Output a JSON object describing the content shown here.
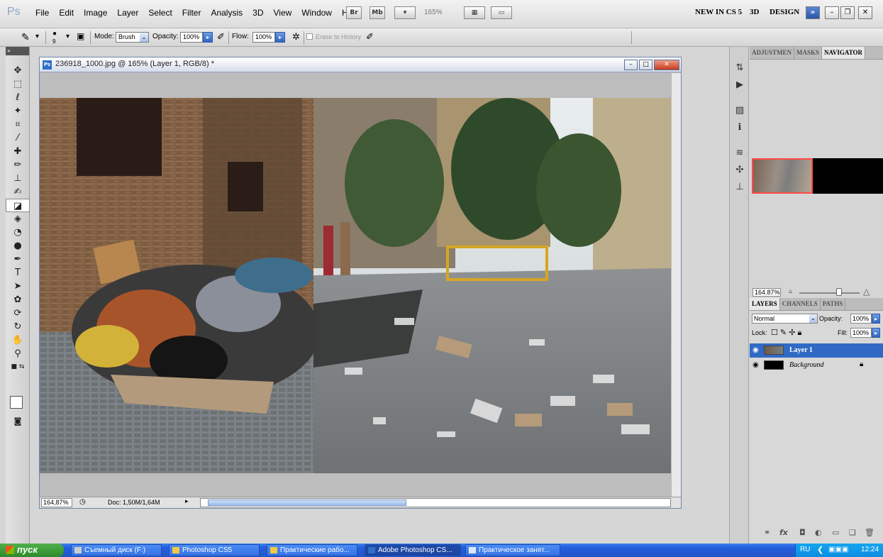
{
  "app": {
    "logo": "Ps",
    "menu": [
      "File",
      "Edit",
      "Image",
      "Layer",
      "Select",
      "Filter",
      "Analysis",
      "3D",
      "View",
      "Window",
      "Help"
    ],
    "bridge": "Br",
    "minibridge": "Mb",
    "zoom_level": "165%",
    "workspaces": [
      "NEW IN CS 5",
      "3D",
      "DESIGN"
    ],
    "more": "»"
  },
  "options": {
    "brush_size": "9",
    "mode_label": "Mode:",
    "mode_value": "Brush",
    "opacity_label": "Opacity:",
    "opacity_value": "100%",
    "flow_label": "Flow:",
    "flow_value": "100%",
    "erase_history": "Erase to History"
  },
  "document": {
    "title": "236918_1000.jpg @ 165% (Layer 1, RGB/8) *",
    "zoom": "164,87%",
    "doc_info": "Doc: 1,50M/1,64M"
  },
  "panels": {
    "top_tabs": [
      "ADJUSTMEN",
      "MASKS",
      "NAVIGATOR"
    ],
    "nav_zoom": "164.87%",
    "layers_tabs": [
      "LAYERS",
      "CHANNELS",
      "PATHS"
    ],
    "blend_mode": "Normal",
    "opacity_label": "Opacity:",
    "opacity_value": "100%",
    "lock_label": "Lock:",
    "fill_label": "Fill:",
    "fill_value": "100%",
    "layers": [
      {
        "name": "Layer 1",
        "selected": true
      },
      {
        "name": "Background",
        "selected": false
      }
    ]
  },
  "taskbar": {
    "start": "пуск",
    "tasks": [
      "Съемный диск (F:)",
      "Photoshop CS5",
      "Практические рабо...",
      "Adobe Photoshop CS...",
      "Практическое занят..."
    ],
    "lang": "RU",
    "time": "12:24"
  },
  "colors": {
    "selection_blue": "#316ac5",
    "taskbar_blue": "#245edb",
    "start_green": "#3b9a36"
  }
}
